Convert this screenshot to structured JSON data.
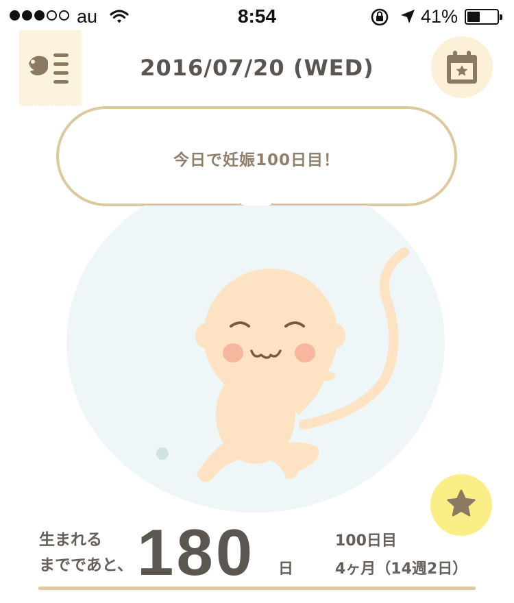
{
  "status_bar": {
    "carrier": "au",
    "time": "8:54",
    "battery_percent": "41%",
    "battery_level": 0.41,
    "signal_bars_filled": 3,
    "signal_bars_total": 5,
    "icons": [
      "wifi-icon",
      "rotation-lock-icon",
      "location-arrow-icon",
      "battery-icon"
    ]
  },
  "header": {
    "date": "2016/07/20 (WED)",
    "menu_icon": "bird-list-icon",
    "calendar_icon": "calendar-star-icon"
  },
  "bubble": {
    "message": "今日で妊娠100日目！"
  },
  "illustration": {
    "subject": "fetus-illustration"
  },
  "favorite": {
    "icon": "star-icon"
  },
  "info": {
    "countdown_label_line1": "生まれる",
    "countdown_label_line2": "までであと、",
    "countdown_value": "180",
    "countdown_unit": "日",
    "pregnancy_day": "100日目",
    "pregnancy_week": "4ヶ月（14週2日）"
  },
  "colors": {
    "accent_beige": "#dcc9a0",
    "menu_bg": "#fcf3de",
    "calendar_bg": "#fcf0d8",
    "favorite_bg": "#fcee86",
    "text_dark": "#5b5650",
    "circle_bg": "#eef6f7",
    "skin": "#fde3c4"
  }
}
